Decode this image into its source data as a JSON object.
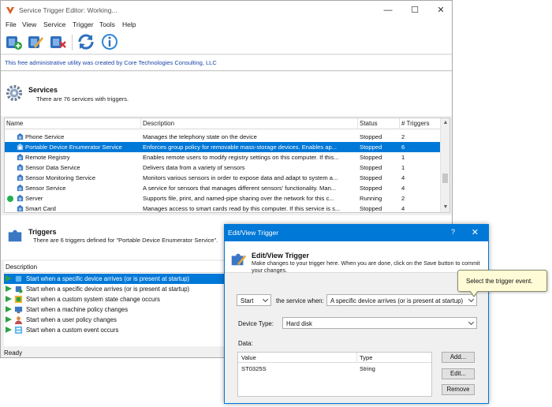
{
  "window": {
    "title": "Service Trigger Editor: Working...",
    "controls": {
      "minimize": "—",
      "maximize": "☐",
      "close": "✕"
    }
  },
  "menu": [
    "File",
    "View",
    "Service",
    "Trigger",
    "Tools",
    "Help"
  ],
  "toolbar": {
    "buttons": [
      "add-trigger-icon",
      "edit-trigger-icon",
      "delete-trigger-icon",
      "refresh-icon",
      "info-icon"
    ]
  },
  "info_bar": {
    "text": "This free administrative utility was created by Core Technologies Consulting, LLC"
  },
  "services": {
    "heading": "Services",
    "subtitle": "There are 76 services with triggers.",
    "columns": [
      "Name",
      "Description",
      "Status",
      "# Triggers"
    ],
    "rows": [
      {
        "name": "Phone Service",
        "description": "Manages the telephony state on the device",
        "status": "Stopped",
        "triggers": "2"
      },
      {
        "name": "Portable Device Enumerator Service",
        "description": "Enforces group policy for removable mass-storage devices. Enables ap...",
        "status": "Stopped",
        "triggers": "6",
        "selected": true
      },
      {
        "name": "Remote Registry",
        "description": "Enables remote users to modify registry settings on this computer. If this...",
        "status": "Stopped",
        "triggers": "1"
      },
      {
        "name": "Sensor Data Service",
        "description": "Delivers data from a variety of sensors",
        "status": "Stopped",
        "triggers": "1"
      },
      {
        "name": "Sensor Monitoring Service",
        "description": "Monitors various sensors in order to expose data and adapt to system a...",
        "status": "Stopped",
        "triggers": "4"
      },
      {
        "name": "Sensor Service",
        "description": "A service for sensors that manages different sensors' functionality. Man...",
        "status": "Stopped",
        "triggers": "4"
      },
      {
        "name": "Server",
        "description": "Supports file, print, and named-pipe sharing over the network for this c...",
        "status": "Running",
        "triggers": "2",
        "running": true
      },
      {
        "name": "Smart Card",
        "description": "Manages access to smart cards read by this computer. If this service is s...",
        "status": "Stopped",
        "triggers": "4"
      }
    ]
  },
  "triggers": {
    "heading": "Triggers",
    "subtitle": "There are 6 triggers defined for \"Portable Device Enumerator Service\".",
    "column": "Description",
    "rows": [
      {
        "text": "Start when a specific device arrives (or is present at startup)",
        "selected": true
      },
      {
        "text": "Start when a specific device arrives (or is present at startup)"
      },
      {
        "text": "Start when a custom system state change occurs"
      },
      {
        "text": "Start when a machine policy changes"
      },
      {
        "text": "Start when a user policy changes"
      },
      {
        "text": "Start when a custom event occurs"
      }
    ]
  },
  "status_bar": "Ready",
  "dialog": {
    "title": "Edit/View Trigger",
    "help": "?",
    "close": "✕",
    "heading": "Edit/View Trigger",
    "description": "Make changes to your trigger here. When you are done, click on the Save button to commit your changes.",
    "action_value": "Start",
    "the_service_when_label": "the service when:",
    "event_value": "A specific device arrives (or is present at startup)",
    "device_type_label": "Device Type:",
    "device_type_value": "Hard disk",
    "data_label": "Data:",
    "data_columns": [
      "Value",
      "Type"
    ],
    "data_rows": [
      {
        "value": "ST0325S",
        "type": "String"
      }
    ],
    "buttons": {
      "add": "Add...",
      "edit": "Edit...",
      "remove": "Remove"
    }
  },
  "tooltip": {
    "text": "Select the trigger event."
  },
  "colors": {
    "selection": "#0078d7",
    "running": "#22b14c",
    "link": "#1a44a8",
    "tooltip_bg": "#fffbd6"
  }
}
